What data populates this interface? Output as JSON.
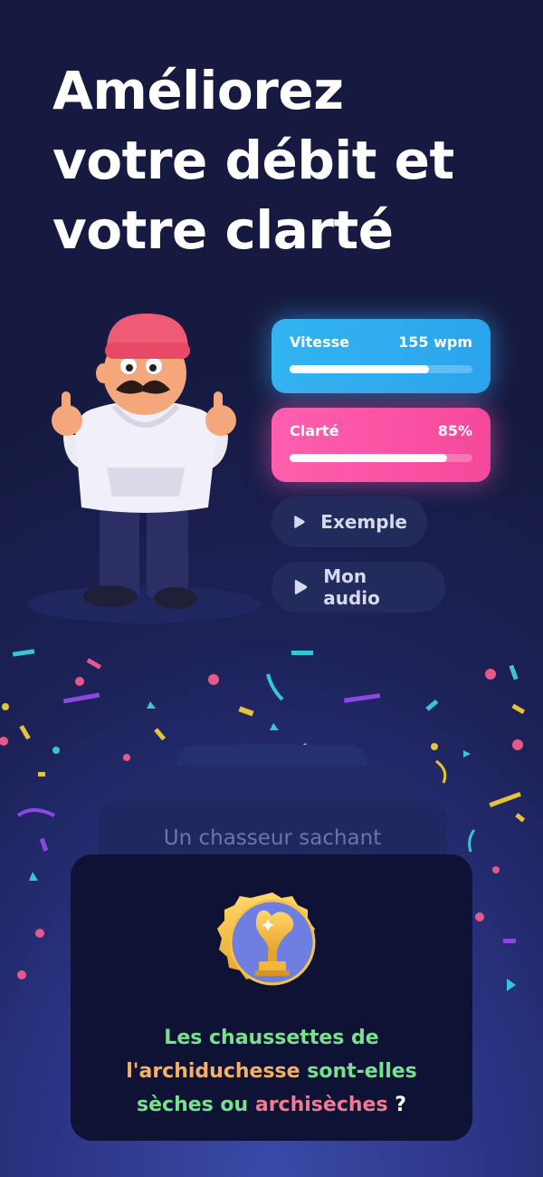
{
  "headline": [
    "Améliorez",
    "votre débit et",
    "votre clarté"
  ],
  "metrics": {
    "speed": {
      "label": "Vitesse",
      "value": "155 wpm",
      "progress_fraction": 0.76,
      "color": "#33b4f2"
    },
    "clarity": {
      "label": "Clarté",
      "value": "85%",
      "progress_fraction": 0.86,
      "color": "#ff5fae"
    }
  },
  "audio_buttons": {
    "example_label": "Exemple",
    "my_audio_label": "Mon audio",
    "icon": "play-icon"
  },
  "card_stack": {
    "background_phrase": "Un chasseur sachant"
  },
  "phrase": {
    "part1": "Les chaussettes de",
    "part2": "l'archiduchesse",
    "part3": " sont-elles",
    "part4": "sèches ou ",
    "part5": "archisèches",
    "part6": " ?"
  },
  "colors": {
    "accent_green": "#79e08e",
    "accent_orange": "#f4b064",
    "accent_pink": "#f07a92"
  }
}
